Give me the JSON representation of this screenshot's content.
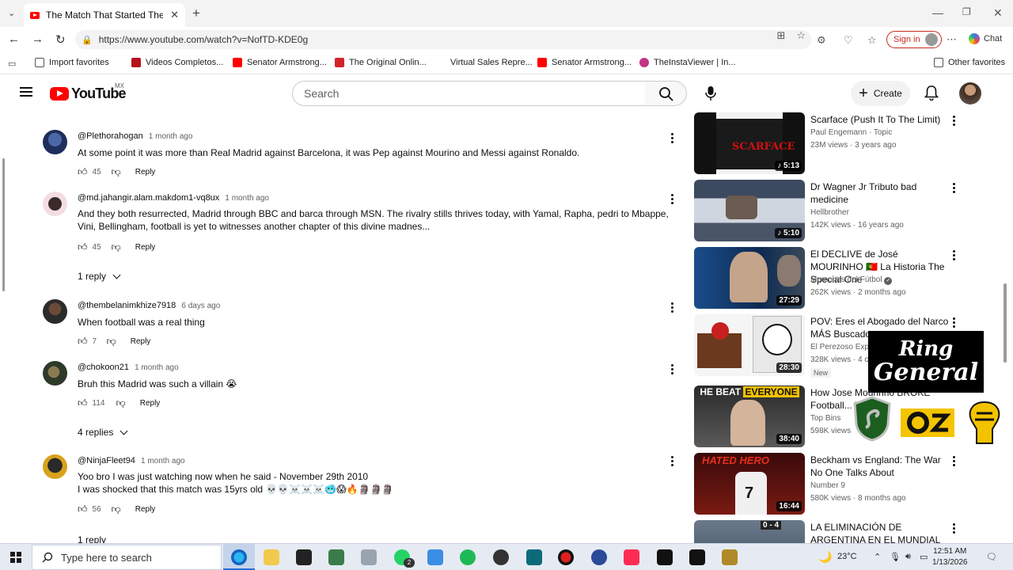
{
  "browser": {
    "tab_title": "The Match That Started The Most",
    "url": "https://www.youtube.com/watch?v=NofTD-KDE0g",
    "signin_label": "Sign in",
    "chat_label": "Chat",
    "favorites": [
      {
        "label": "Import favorites",
        "color": "#555555"
      },
      {
        "label": "Videos Completos...",
        "color": "#b5121b"
      },
      {
        "label": "Senator Armstrong...",
        "color": "#ff0000"
      },
      {
        "label": "The Original Onlin...",
        "color": "#d2232a"
      },
      {
        "label": "Virtual Sales Repre...",
        "color": "#ffffff"
      },
      {
        "label": "Senator Armstrong...",
        "color": "#ff0000"
      },
      {
        "label": "TheInstaViewer | In...",
        "color": "#c13584"
      }
    ],
    "other_favorites": "Other favorites"
  },
  "youtube": {
    "logo_text": "YouTube",
    "country_code": "MX",
    "search_placeholder": "Search",
    "create_label": "Create"
  },
  "comments": [
    {
      "handle": "@Plethorahogan",
      "time": "1 month ago",
      "text": "At some point it was more than Real Madrid against Barcelona, it was Pep against Mourino and Messi against Ronaldo.",
      "likes": "45",
      "reply_label": "Reply"
    },
    {
      "handle": "@md.jahangir.alam.makdom1-vq8ux",
      "time": "1 month ago",
      "text": "And they both resurrected, Madrid through BBC and barca through MSN. The rivalry stills thrives today, with Yamal, Rapha, pedri to Mbappe, Vini, Bellingham, football is yet to witnesses another chapter of this divine madnes...",
      "likes": "45",
      "reply_label": "Reply",
      "replies": "1 reply"
    },
    {
      "handle": "@thembelanimkhize7918",
      "time": "6 days ago",
      "text": "When football was a real thing",
      "likes": "7",
      "reply_label": "Reply"
    },
    {
      "handle": "@chokoon21",
      "time": "1 month ago",
      "text": "Bruh this Madrid was such a villain 😭",
      "likes": "114",
      "reply_label": "Reply",
      "replies": "4 replies"
    },
    {
      "handle": "@NinjaFleet94",
      "time": "1 month ago",
      "text_line1": "Yoo bro I was just watching now when he said - November 29th 2010",
      "text_line2": "I was shocked  that this match was 15yrs old 💀💀☠️☠️☠️🥶😱🔥🗿🗿🗿",
      "likes": "56",
      "reply_label": "Reply",
      "replies": "1 reply"
    }
  ],
  "side_videos": [
    {
      "title": "Scarface (Push It To The Limit)",
      "channel": "Paul Engemann · Topic",
      "meta": "23M views · 3 years ago",
      "duration": "5:13",
      "music": true
    },
    {
      "title": "Dr Wagner Jr Tributo bad medicine",
      "channel": "Hellbrother",
      "meta": "142K views · 16 years ago",
      "duration": "5:10",
      "music": true
    },
    {
      "title": "El DECLIVE de José MOURINHO 🇵🇹 La Historia The Special One",
      "channel": "Memorias del Fútbol",
      "meta": "262K views · 2 months ago",
      "duration": "27:29"
    },
    {
      "title": "POV: Eres el Abogado del Narco MÁS Buscado",
      "channel": "El Perezoso Expl",
      "meta": "328K views · 4 c",
      "duration": "28:30",
      "badge": "New"
    },
    {
      "title": "How Jose Mourinho BROKE Football... 7",
      "channel": "Top Bins",
      "meta": "598K views",
      "duration": "38:40",
      "thumb_text1": "HE BEAT",
      "thumb_text2": "EVERYONE"
    },
    {
      "title": "Beckham vs England: The War No One Talks About",
      "channel": "Number 9",
      "meta": "580K views · 8 months ago",
      "duration": "16:44",
      "thumb_text1": "HATED",
      "thumb_text2": "HERO"
    },
    {
      "title": "LA ELIMINACIÓN DE ARGENTINA EN EL MUNDIAL",
      "channel": "",
      "meta": "",
      "duration": "",
      "thumb_text1": "0 - 4"
    }
  ],
  "overlay": {
    "ring_line1": "Ring",
    "ring_line2": "General"
  },
  "taskbar": {
    "search_placeholder": "Type here to search",
    "whatsapp_badge": "2",
    "temperature": "23°C",
    "time": "12:51 AM",
    "date": "1/13/2026"
  }
}
